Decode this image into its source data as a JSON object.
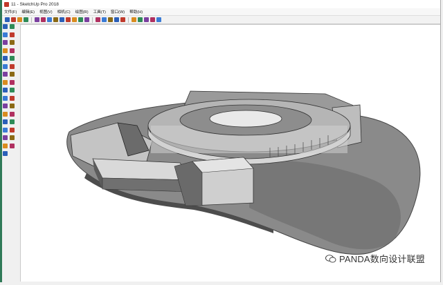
{
  "window": {
    "title": "11 - SketchUp Pro 2018"
  },
  "menu": {
    "items": [
      "文件(F)",
      "编辑(E)",
      "视图(V)",
      "相机(C)",
      "绘图(R)",
      "工具(T)",
      "窗口(W)",
      "帮助(H)"
    ]
  },
  "toolbar": {
    "icons": [
      "select-icon",
      "eraser-icon",
      "pencil-icon",
      "arc-icon",
      "shape-icon",
      "push-pull-icon",
      "move-icon",
      "rotate-icon",
      "scale-icon",
      "offset-icon",
      "tape-measure-icon",
      "text-icon",
      "axes-icon",
      "3d-text-icon",
      "orbit-icon",
      "pan-icon",
      "zoom-icon",
      "zoom-extents-icon",
      "previous-view-icon",
      "section-plane-icon",
      "warehouse-icon",
      "extension-icon",
      "layout-icon"
    ]
  },
  "palette": {
    "icons": [
      "select-icon",
      "component-icon",
      "paint-icon",
      "eraser-icon",
      "line-icon",
      "freehand-icon",
      "rectangle-icon",
      "rotated-rectangle-icon",
      "circle-icon",
      "polygon-icon",
      "arc-icon",
      "pie-icon",
      "move-icon",
      "push-pull-icon",
      "rotate-icon",
      "follow-me-icon",
      "scale-icon",
      "offset-icon",
      "tape-icon",
      "dimension-icon",
      "protractor-icon",
      "text-icon",
      "axes-icon",
      "3d-text-icon",
      "orbit-icon",
      "pan-icon",
      "zoom-icon",
      "zoom-window-icon",
      "zoom-extents-icon",
      "walk-icon",
      "look-around-icon",
      "position-camera-icon",
      "section-plane-icon"
    ]
  },
  "colors": {
    "viewport_bg": "#ffffff",
    "terrain": "#8c8c8c",
    "building_light": "#d9d9d9",
    "building_dark": "#5a5a5a"
  },
  "watermark": {
    "text": "PANDA数向设计联盟"
  }
}
